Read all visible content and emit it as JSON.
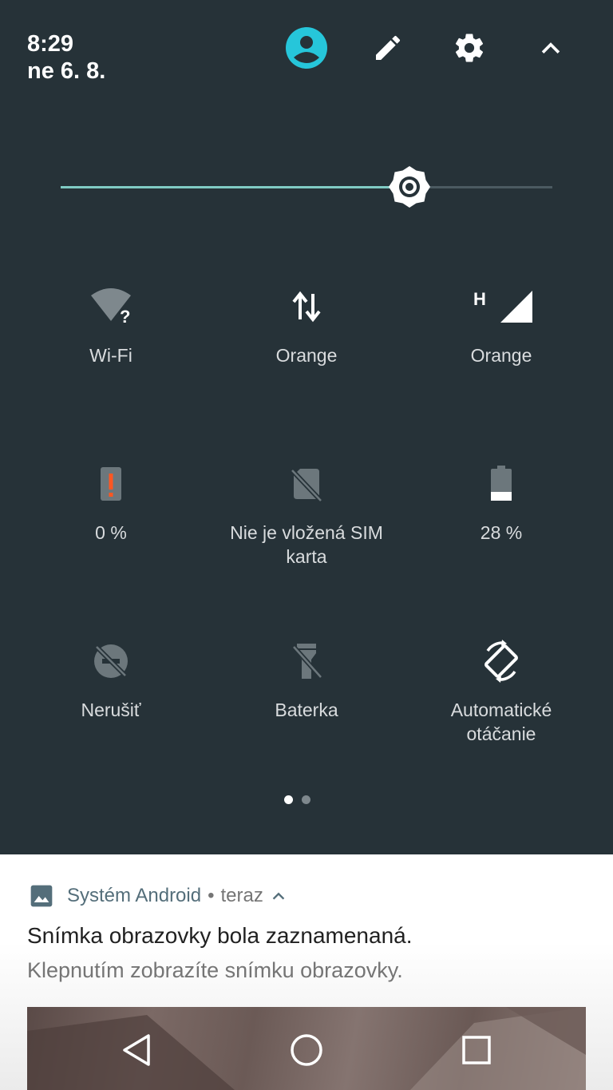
{
  "status": {
    "time": "8:29",
    "date": "ne 6. 8."
  },
  "header_icons": [
    "user-icon",
    "edit-icon",
    "settings-icon",
    "collapse-icon"
  ],
  "brightness": {
    "level": 0.71
  },
  "tiles": [
    {
      "label": "Wi-Fi",
      "icon": "wifi-unknown-icon"
    },
    {
      "label": "Orange",
      "icon": "mobile-data-icon"
    },
    {
      "label": "Orange",
      "icon": "cell-signal-icon",
      "badge": "H"
    },
    {
      "label": "0 %",
      "icon": "battery-alert-icon"
    },
    {
      "label": "Nie je vložená SIM\nkarta",
      "icon": "no-sim-icon"
    },
    {
      "label": "28 %",
      "icon": "battery-icon"
    },
    {
      "label": "Nerušiť",
      "icon": "do-not-disturb-off-icon"
    },
    {
      "label": "Baterka",
      "icon": "flashlight-off-icon"
    },
    {
      "label": "Automatické\notáčanie",
      "icon": "auto-rotate-icon"
    }
  ],
  "pager": {
    "pages": 2,
    "current": 1
  },
  "notification": {
    "app": "Systém Android",
    "separator": "•",
    "when": "teraz",
    "title": "Snímka obrazovky bola zaznamenaná.",
    "text": "Klepnutím zobrazíte snímku obrazovky."
  },
  "colors": {
    "panel": "#263238",
    "accent": "#80cbc4",
    "avatar": "#26c6da",
    "alert": "#ff5722",
    "app_name": "#546e7a"
  }
}
